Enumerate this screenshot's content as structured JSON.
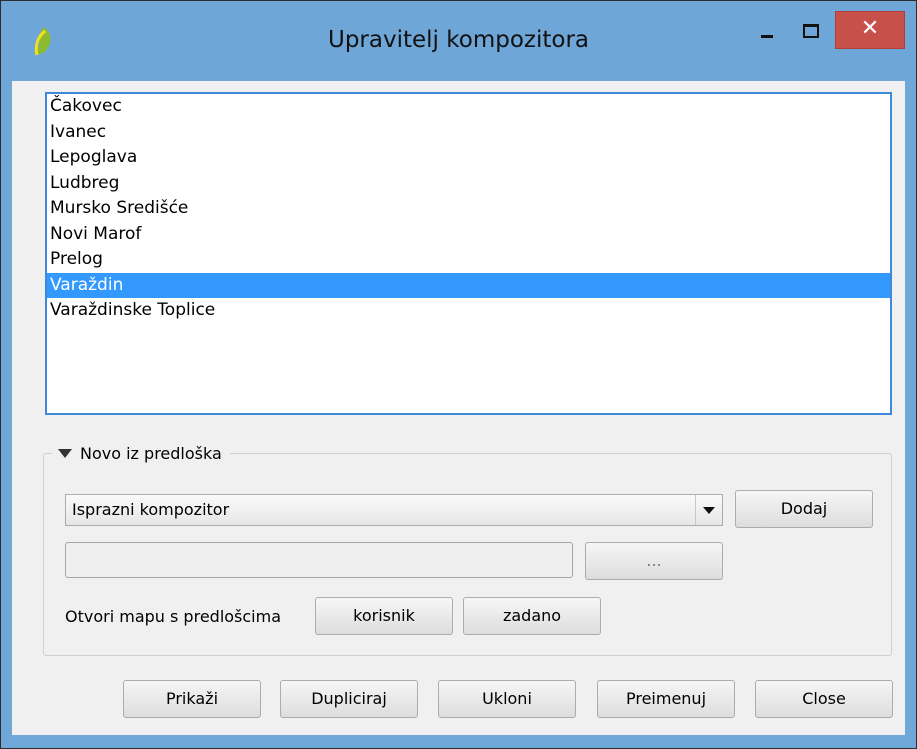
{
  "window": {
    "title": "Upravitelj kompozitora",
    "icon": "qgis-icon"
  },
  "composers": {
    "items": [
      "Čakovec",
      "Ivanec",
      "Lepoglava",
      "Ludbreg",
      "Mursko Središće",
      "Novi Marof",
      "Prelog",
      "Varaždin",
      "Varaždinske Toplice"
    ],
    "selected_index": 7
  },
  "template_group": {
    "title": "Novo iz predloška",
    "template_select": "Isprazni kompozitor",
    "add_label": "Dodaj",
    "path_value": "",
    "browse_label": "...",
    "open_folder_label": "Otvori mapu s predlošcima",
    "user_label": "korisnik",
    "default_label": "zadano"
  },
  "actions": {
    "show": "Prikaži",
    "duplicate": "Dupliciraj",
    "remove": "Ukloni",
    "rename": "Preimenuj",
    "close": "Close"
  },
  "colors": {
    "selection": "#3399ff",
    "titlebar": "#6ea6d7",
    "close_button": "#c7504b"
  }
}
